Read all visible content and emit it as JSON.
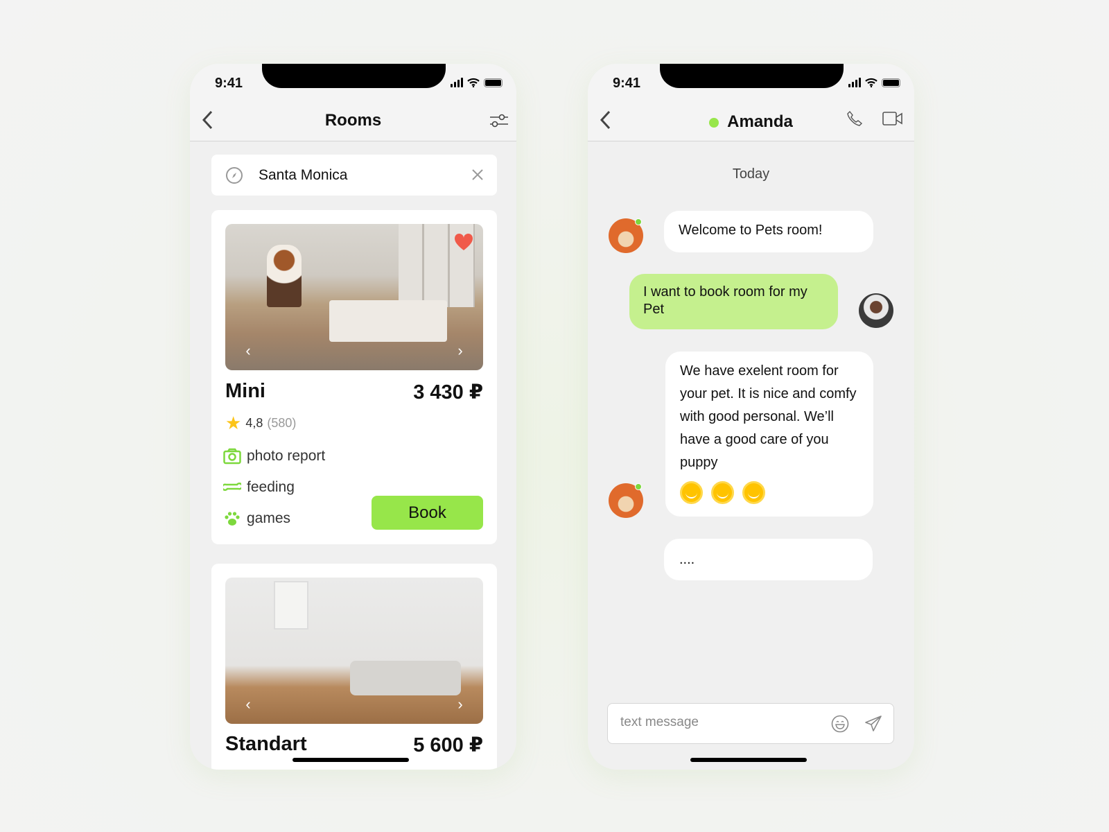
{
  "status": {
    "time": "9:41"
  },
  "rooms_screen": {
    "title": "Rooms",
    "search": {
      "value": "Santa Monica"
    },
    "rooms": [
      {
        "name": "Mini",
        "price": "3 430 ₽",
        "rating": "4,8",
        "reviews": "(580)",
        "favorite": true,
        "features": [
          {
            "icon": "camera-icon",
            "label": "photo report"
          },
          {
            "icon": "bone-icon",
            "label": "feeding"
          },
          {
            "icon": "paw-icon",
            "label": "games"
          }
        ],
        "book_label": "Book"
      },
      {
        "name": "Standart",
        "price": "5 600 ₽"
      }
    ]
  },
  "chat_screen": {
    "contact": "Amanda",
    "online": true,
    "date_label": "Today",
    "messages": [
      {
        "from": "them",
        "text": "Welcome to Pets room!"
      },
      {
        "from": "me",
        "text": "I want to book room for my Pet"
      },
      {
        "from": "them",
        "text": "We have exelent room for your pet. It is nice and comfy with good personal. We’ll have a good care of you puppy",
        "emojis": 3
      },
      {
        "from": "them",
        "text": "...."
      }
    ],
    "input_placeholder": "text message"
  },
  "colors": {
    "accent": "#97e64a",
    "bubble_me": "#c5f08e",
    "online": "#7dd83d",
    "heart": "#f05a4a",
    "star": "#fcc419"
  }
}
